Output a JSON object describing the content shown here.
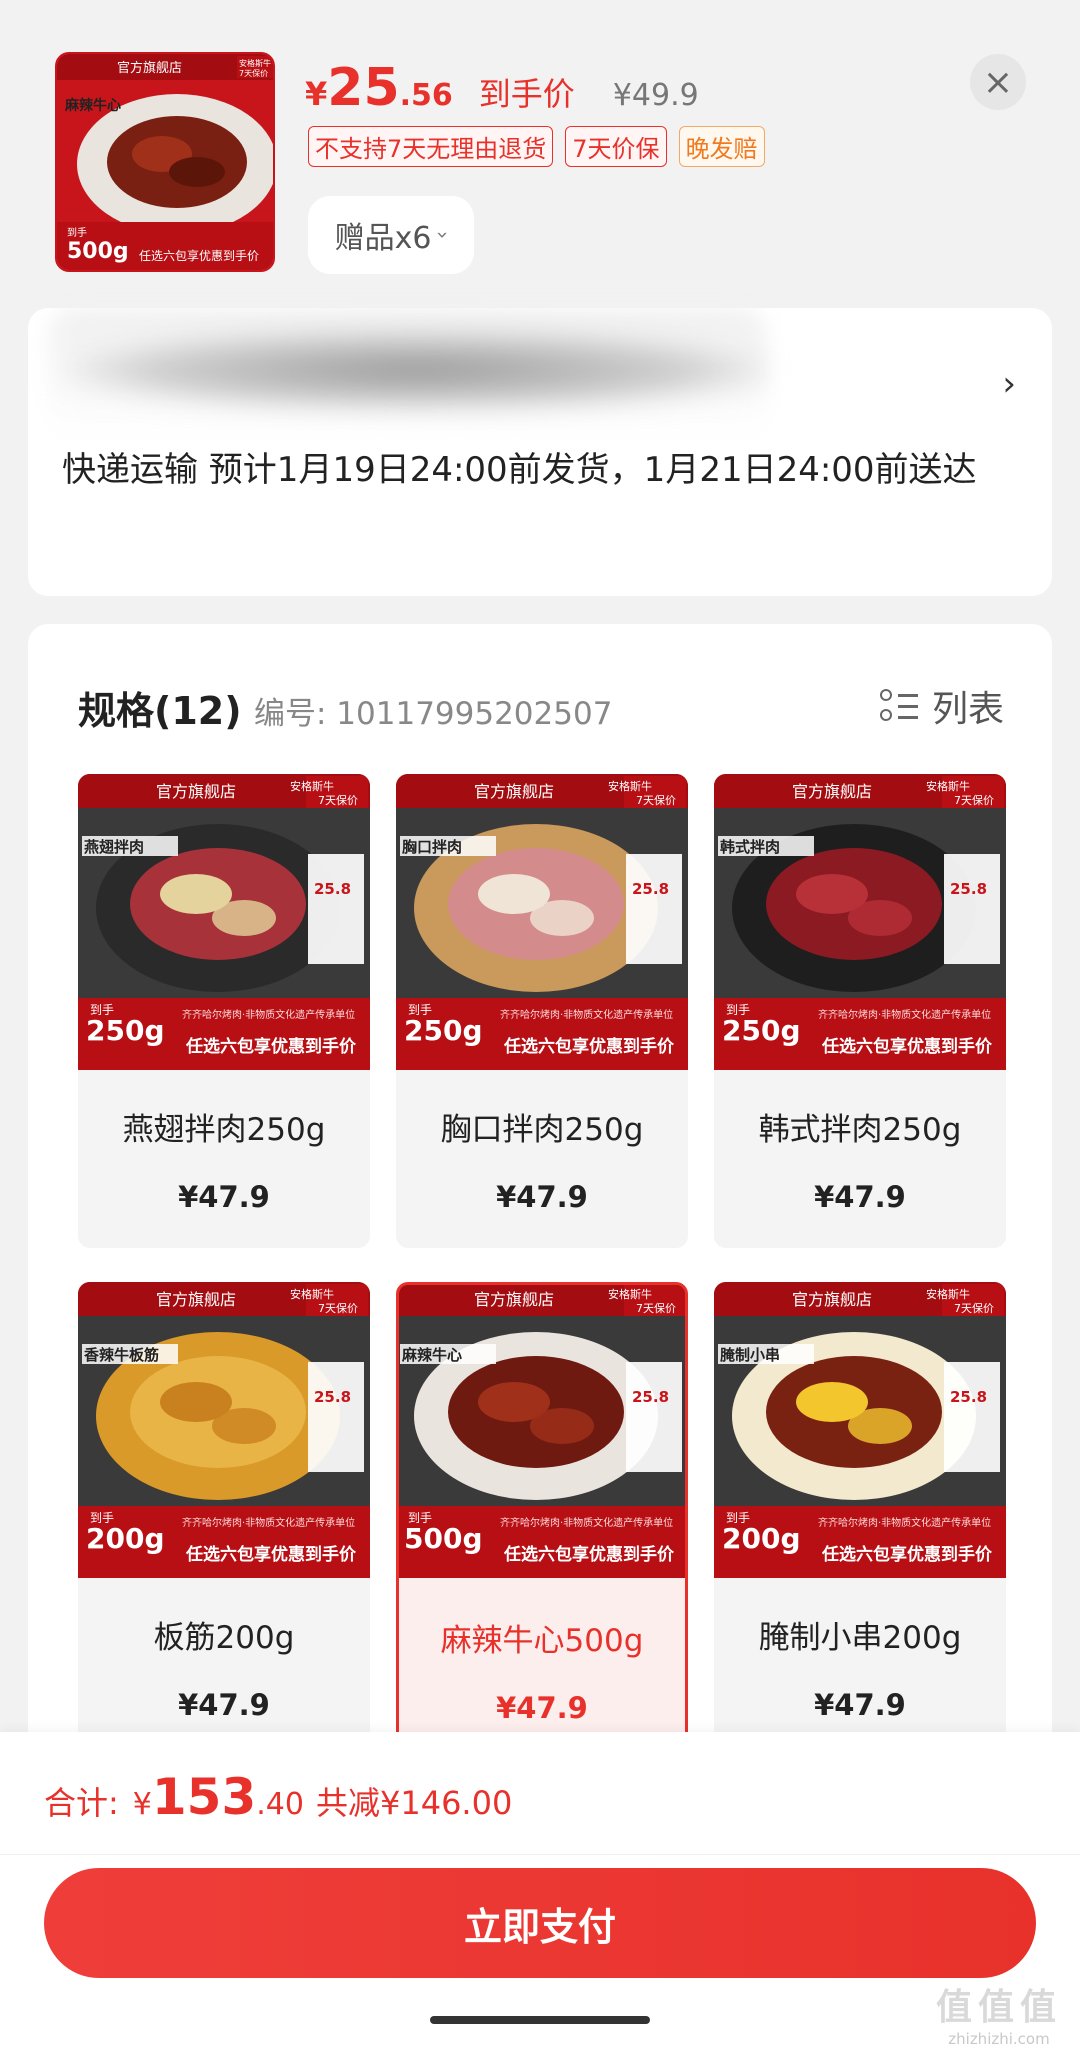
{
  "header": {
    "price_symbol": "¥",
    "price_integer": "25",
    "price_decimal": ".56",
    "price_tag": "到手价",
    "original_price": "¥49.9",
    "tags": [
      "不支持7天无理由退货",
      "7天价保",
      "晚发赔"
    ],
    "gift_label": "赠品x6",
    "close_icon": "close-icon",
    "thumb": {
      "store": "官方旗舰店",
      "badge1": "安格斯牛",
      "badge2": "7天保价",
      "label": "麻辣牛心",
      "weight_prefix": "到手",
      "weight": "500g",
      "promo": "任选六包享优惠到手价"
    }
  },
  "address": {
    "arrow_icon": "chevron-right-icon",
    "delivery": "快递运输 预计1月19日24:00前发货，1月21日24:00前送达"
  },
  "spec": {
    "title": "规格(12)",
    "number": "编号: 10117995202507",
    "view_label": "列表",
    "view_icon": "list-icon",
    "items": [
      {
        "name": "燕翅拌肉250g",
        "price": "¥47.9",
        "img_label": "燕翅拌肉",
        "weight": "250g",
        "store": "官方旗舰店",
        "badge1": "安格斯牛",
        "badge2": "7天保价",
        "sub": "齐齐哈尔烤肉·非物质文化遗产传承单位",
        "promo": "任选六包享优惠到手价",
        "weight_prefix": "到手",
        "mini_price": "25.8",
        "selected": false
      },
      {
        "name": "胸口拌肉250g",
        "price": "¥47.9",
        "img_label": "胸口拌肉",
        "weight": "250g",
        "store": "官方旗舰店",
        "badge1": "安格斯牛",
        "badge2": "7天保价",
        "sub": "齐齐哈尔烤肉·非物质文化遗产传承单位",
        "promo": "任选六包享优惠到手价",
        "weight_prefix": "到手",
        "mini_price": "25.8",
        "selected": false
      },
      {
        "name": "韩式拌肉250g",
        "price": "¥47.9",
        "img_label": "韩式拌肉",
        "weight": "250g",
        "store": "官方旗舰店",
        "badge1": "安格斯牛",
        "badge2": "7天保价",
        "sub": "齐齐哈尔烤肉·非物质文化遗产传承单位",
        "promo": "任选六包享优惠到手价",
        "weight_prefix": "到手",
        "mini_price": "25.8",
        "selected": false
      },
      {
        "name": "板筋200g",
        "price": "¥47.9",
        "img_label": "香辣牛板筋",
        "weight": "200g",
        "store": "官方旗舰店",
        "badge1": "安格斯牛",
        "badge2": "7天保价",
        "sub": "齐齐哈尔烤肉·非物质文化遗产传承单位",
        "promo": "任选六包享优惠到手价",
        "weight_prefix": "到手",
        "mini_price": "25.8",
        "selected": false
      },
      {
        "name": "麻辣牛心500g",
        "price": "¥47.9",
        "img_label": "麻辣牛心",
        "weight": "500g",
        "store": "官方旗舰店",
        "badge1": "安格斯牛",
        "badge2": "7天保价",
        "sub": "齐齐哈尔烤肉·非物质文化遗产传承单位",
        "promo": "任选六包享优惠到手价",
        "weight_prefix": "到手",
        "mini_price": "25.8",
        "selected": true
      },
      {
        "name": "腌制小串200g",
        "price": "¥47.9",
        "img_label": "腌制小串",
        "weight": "200g",
        "store": "官方旗舰店",
        "badge1": "安格斯牛",
        "badge2": "7天保价",
        "sub": "齐齐哈尔烤肉·非物质文化遗产传承单位",
        "promo": "任选六包享优惠到手价",
        "weight_prefix": "到手",
        "mini_price": "25.8",
        "selected": false
      }
    ]
  },
  "bottom": {
    "total_label": "合计:",
    "total_symbol": "¥",
    "total_integer": "153",
    "total_decimal": ".40",
    "total_save": "共减¥146.00",
    "pay_label": "立即支付"
  },
  "watermark": {
    "logo": "值值值",
    "url": "zhizhizhi.com"
  },
  "colors": {
    "accent": "#e8312b",
    "brand_red": "#c8151b",
    "tag_orange": "#f07a1f"
  }
}
